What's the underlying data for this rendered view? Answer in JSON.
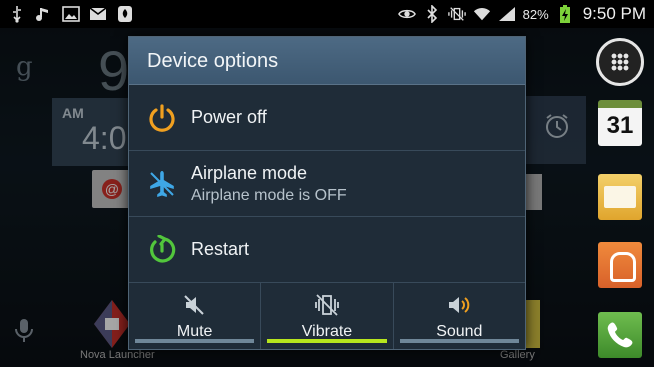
{
  "status_bar": {
    "time": "9:50 PM",
    "battery_percent": "82%",
    "left_icons": [
      "usb-icon",
      "music-icon",
      "image-icon",
      "gmail-icon",
      "dropbox-icon"
    ],
    "right_icons": [
      "smart-stay-eye-icon",
      "bluetooth-icon",
      "vibrate-icon",
      "wifi-icon",
      "signal-icon",
      "battery-charging-icon"
    ]
  },
  "background": {
    "clock_fragment": "9",
    "weather_am": "AM",
    "weather_time": "4:0",
    "calendar_day": "31",
    "nova_label": "Nova Launcher",
    "gallery_label": "Gallery"
  },
  "dialog": {
    "title": "Device options",
    "options": [
      {
        "label": "Power off",
        "icon": "power-icon"
      },
      {
        "label": "Airplane mode",
        "sublabel": "Airplane mode is OFF",
        "icon": "airplane-icon"
      },
      {
        "label": "Restart",
        "icon": "restart-icon"
      }
    ],
    "sound_modes": [
      {
        "label": "Mute",
        "icon": "mute-icon",
        "active": false
      },
      {
        "label": "Vibrate",
        "icon": "vibrate-icon",
        "active": true
      },
      {
        "label": "Sound",
        "icon": "sound-icon",
        "active": false
      }
    ]
  },
  "colors": {
    "accent_orange": "#f0a020",
    "accent_blue": "#3ea7e6",
    "accent_green": "#52c63c",
    "active_mode_bar": "#b7e61e",
    "dialog_bg": "#1f2c38",
    "title_bar": "#4d6a84"
  }
}
